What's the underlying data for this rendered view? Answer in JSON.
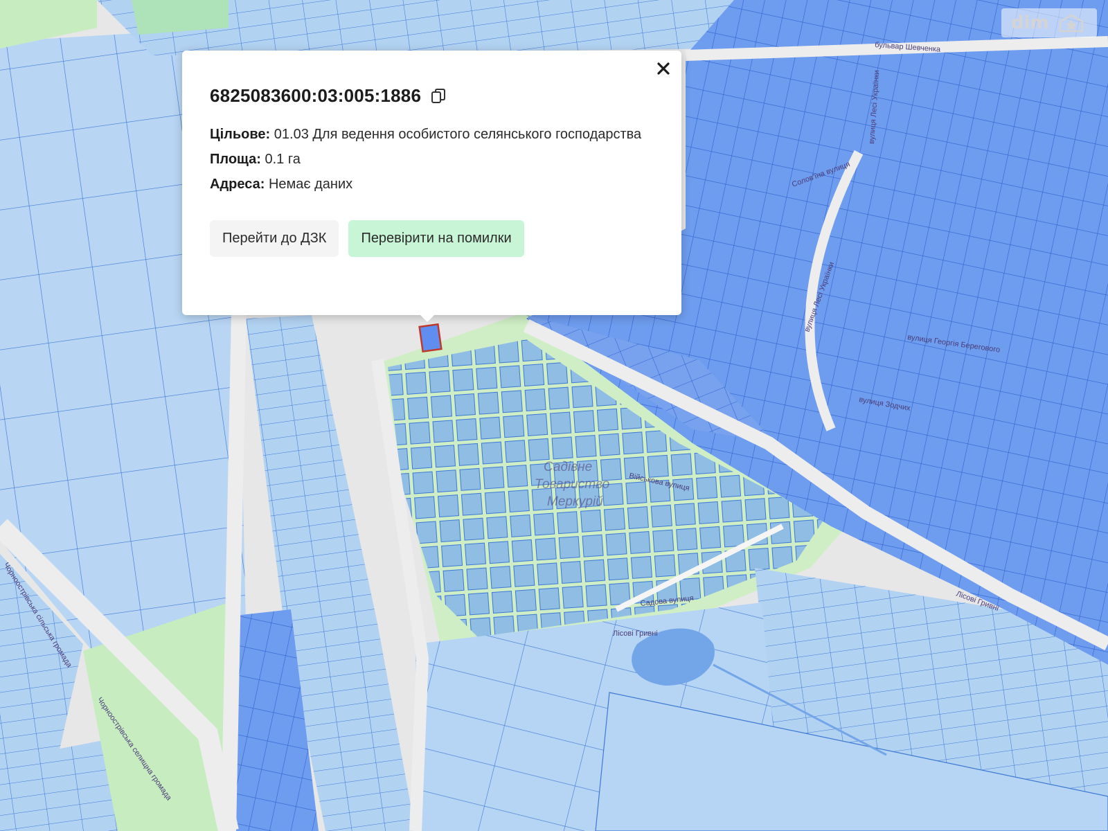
{
  "popup": {
    "cadastral_number": "6825083600:03:005:1886",
    "purpose_label": "Цільове:",
    "purpose_value": "01.03 Для ведення особистого селянського господарства",
    "area_label": "Площа:",
    "area_value": "0.1 га",
    "address_label": "Адреса:",
    "address_value": "Немає даних",
    "button_dzk": "Перейти до ДЗК",
    "button_check": "Перевірити на помилки",
    "icons": {
      "copy": "copy-icon",
      "close": "close-icon"
    }
  },
  "map": {
    "labels": {
      "garden_society_1": "Садівне",
      "garden_society_2": "Товариство",
      "garden_society_3": "Меркурій",
      "shevchenko": "бульвар Шевченка",
      "lesi": "вулиця Лесі Українки",
      "solovyina": "Солов'їна вулиця",
      "berehovoho": "вулиця Георгія Берегового",
      "zodchykh": "вулиця Зодчих",
      "viiskova": "Військова вулиця",
      "sadova": "Садова вулиця",
      "lisovi": "Лісові Гривні",
      "lisovi2": "Лісові Гривні",
      "lesi2": "вулиця Лесі Українки",
      "community1": "Чорноострівська сільська громада",
      "community2": "Чорноострівська селищна громада"
    },
    "colors": {
      "parcel_fill": "#b4d4f3",
      "parcel_stroke": "#4a7fd6",
      "dense_fill": "#6f9cef",
      "green_area": "#cfeec5",
      "selected_stroke": "#c0392b",
      "water": "#73a6e9"
    }
  },
  "watermark": {
    "text": "dim",
    "icon": "star-house-icon"
  }
}
